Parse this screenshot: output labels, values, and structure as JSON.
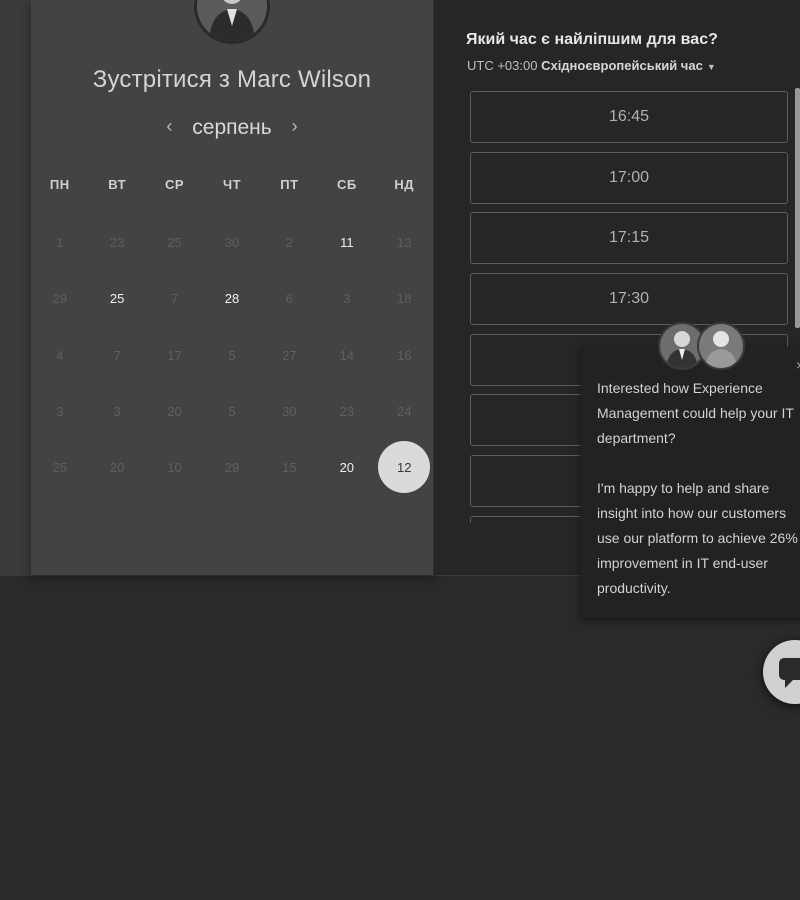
{
  "calendar": {
    "title": "Зустрітися з Marc Wilson",
    "month": "серпень",
    "prev_icon": "‹",
    "next_icon": "›",
    "weekdays": [
      "ПН",
      "ВТ",
      "СР",
      "ЧТ",
      "ПТ",
      "СБ",
      "НД"
    ],
    "weeks": [
      [
        "1",
        "23",
        "25",
        "30",
        "2",
        "11",
        "13"
      ],
      [
        "29",
        "25",
        "7",
        "28",
        "6",
        "3",
        "18"
      ],
      [
        "4",
        "7",
        "17",
        "5",
        "27",
        "14",
        "16"
      ],
      [
        "3",
        "3",
        "20",
        "5",
        "30",
        "23",
        "24"
      ],
      [
        "25",
        "20",
        "10",
        "29",
        "15",
        "20",
        "12"
      ]
    ]
  },
  "time": {
    "question": "Який час є найліпшим для вас?",
    "tz_offset": "UTC +03:00",
    "tz_name": "Східноєвропейський час",
    "slots": [
      "16:45",
      "17:00",
      "17:15",
      "17:30",
      "",
      "",
      ""
    ]
  },
  "chat": {
    "close_icon": "×",
    "paragraph1": "Interested how Experience Management could help your IT department?",
    "paragraph2": "I'm happy to help and share insight into how our customers use our platform to achieve 26% improvement in IT end-user productivity."
  }
}
